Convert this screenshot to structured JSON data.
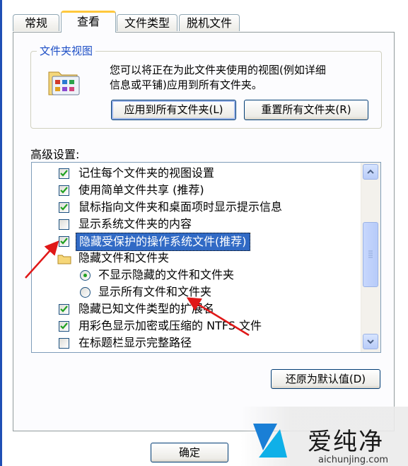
{
  "tabs": [
    {
      "label": "常规"
    },
    {
      "label": "查看"
    },
    {
      "label": "文件类型"
    },
    {
      "label": "脱机文件"
    }
  ],
  "folder_views": {
    "legend": "文件夹视图",
    "description_line1": "您可以将正在为此文件夹使用的视图(例如详细",
    "description_line2": "信息或平铺)应用到所有文件夹。",
    "apply_button": "应用到所有文件夹(L)",
    "reset_button": "重置所有文件夹(R)"
  },
  "advanced": {
    "label": "高级设置:",
    "items": [
      {
        "type": "checkbox",
        "checked": true,
        "label": "记住每个文件夹的视图设置"
      },
      {
        "type": "checkbox",
        "checked": true,
        "label": "使用简单文件共享 (推荐)"
      },
      {
        "type": "checkbox",
        "checked": true,
        "label": "鼠标指向文件夹和桌面项时显示提示信息"
      },
      {
        "type": "checkbox",
        "checked": false,
        "label": "显示系统文件夹的内容"
      },
      {
        "type": "checkbox",
        "checked": true,
        "label": "隐藏受保护的操作系统文件(推荐)",
        "selected": true
      },
      {
        "type": "folder",
        "label": "隐藏文件和文件夹"
      },
      {
        "type": "radio",
        "checked": true,
        "label": "不显示隐藏的文件和文件夹"
      },
      {
        "type": "radio",
        "checked": false,
        "label": "显示所有文件和文件夹"
      },
      {
        "type": "checkbox",
        "checked": true,
        "label": "隐藏已知文件类型的扩展名"
      },
      {
        "type": "checkbox",
        "checked": true,
        "label": "用彩色显示加密或压缩的 NTFS 文件"
      },
      {
        "type": "checkbox",
        "checked": false,
        "label": "在标题栏显示完整路径"
      }
    ],
    "restore_button": "还原为默认值(D)"
  },
  "footer": {
    "ok_button": "确定"
  },
  "watermark": {
    "brand": "爱纯净",
    "url": "aichunjing.com"
  },
  "colors": {
    "selection": "#316ac5",
    "annotation_arrow": "#e01818",
    "legend_text": "#1e4fc6",
    "check": "#21a121"
  }
}
